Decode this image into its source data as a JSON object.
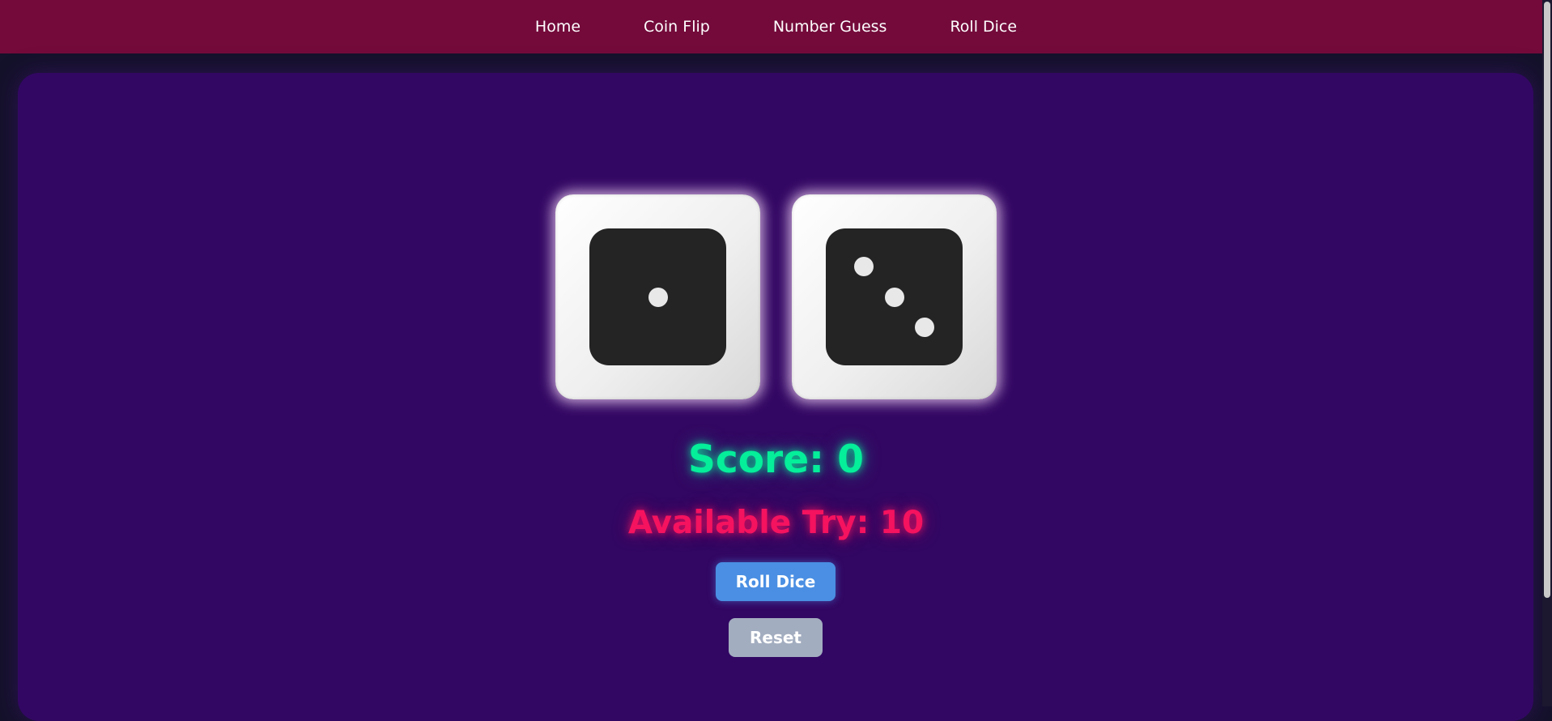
{
  "nav": {
    "links": [
      {
        "label": "Home"
      },
      {
        "label": "Coin Flip"
      },
      {
        "label": "Number Guess"
      },
      {
        "label": "Roll Dice"
      }
    ]
  },
  "dice": {
    "values": [
      1,
      3
    ]
  },
  "game": {
    "score_text": "Score: 0",
    "tries_text": "Available Try: 10"
  },
  "buttons": {
    "roll_label": "Roll Dice",
    "reset_label": "Reset"
  },
  "colors": {
    "navbar": "#730a3a",
    "panel": "#320763",
    "score": "#05ee9a",
    "tries": "#f5125f",
    "roll_button": "#4a8fe3",
    "reset_button": "#a3adc0"
  }
}
